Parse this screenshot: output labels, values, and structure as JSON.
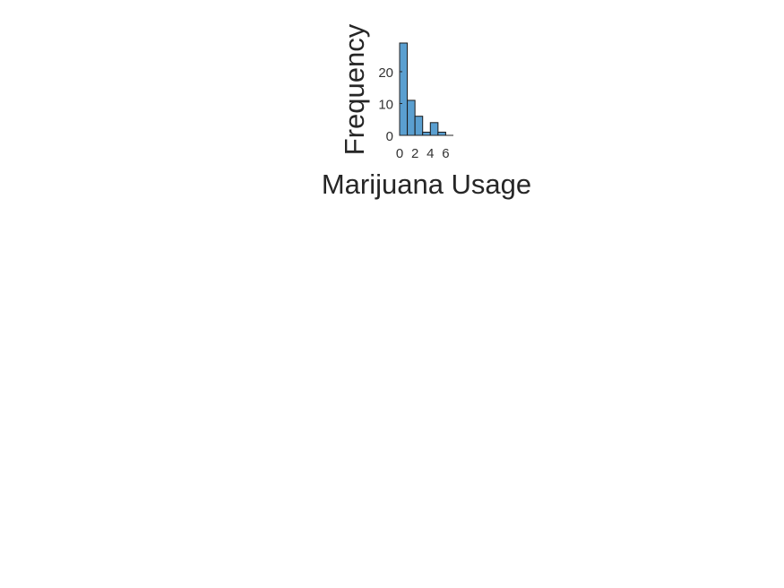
{
  "chart_data": {
    "type": "bar",
    "subtype": "histogram",
    "bins": [
      {
        "start": 0,
        "end": 1,
        "count": 29
      },
      {
        "start": 1,
        "end": 2,
        "count": 11
      },
      {
        "start": 2,
        "end": 3,
        "count": 6
      },
      {
        "start": 3,
        "end": 4,
        "count": 1
      },
      {
        "start": 4,
        "end": 5,
        "count": 4
      },
      {
        "start": 5,
        "end": 6,
        "count": 1
      },
      {
        "start": 6,
        "end": 7,
        "count": 0
      }
    ],
    "title": "",
    "xlabel": "Marijuana Usage",
    "ylabel": "Frequency",
    "xlim": [
      0,
      7
    ],
    "ylim": [
      0,
      29
    ],
    "xticks": [
      0,
      2,
      4,
      6
    ],
    "yticks": [
      0,
      10,
      20
    ],
    "grid": false,
    "bar_color": "#5a9fd0",
    "edge_color": "#1a1a1a"
  }
}
